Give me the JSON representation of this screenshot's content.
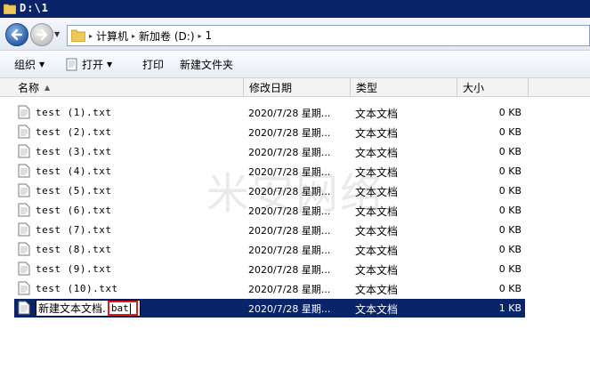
{
  "window": {
    "title": "D:\\1"
  },
  "address": {
    "crumbs": [
      "计算机",
      "新加卷 (D:)",
      "1"
    ]
  },
  "toolbar": {
    "organize": "组织",
    "open": "打开",
    "print": "打印",
    "new_folder": "新建文件夹"
  },
  "columns": {
    "name": "名称",
    "date": "修改日期",
    "type": "类型",
    "size": "大小"
  },
  "files": [
    {
      "name": "test (1).txt",
      "date": "2020/7/28 星期...",
      "type": "文本文档",
      "size": "0 KB"
    },
    {
      "name": "test (2).txt",
      "date": "2020/7/28 星期...",
      "type": "文本文档",
      "size": "0 KB"
    },
    {
      "name": "test (3).txt",
      "date": "2020/7/28 星期...",
      "type": "文本文档",
      "size": "0 KB"
    },
    {
      "name": "test (4).txt",
      "date": "2020/7/28 星期...",
      "type": "文本文档",
      "size": "0 KB"
    },
    {
      "name": "test (5).txt",
      "date": "2020/7/28 星期...",
      "type": "文本文档",
      "size": "0 KB"
    },
    {
      "name": "test (6).txt",
      "date": "2020/7/28 星期...",
      "type": "文本文档",
      "size": "0 KB"
    },
    {
      "name": "test (7).txt",
      "date": "2020/7/28 星期...",
      "type": "文本文档",
      "size": "0 KB"
    },
    {
      "name": "test (8).txt",
      "date": "2020/7/28 星期...",
      "type": "文本文档",
      "size": "0 KB"
    },
    {
      "name": "test (9).txt",
      "date": "2020/7/28 星期...",
      "type": "文本文档",
      "size": "0 KB"
    },
    {
      "name": "test (10).txt",
      "date": "2020/7/28 星期...",
      "type": "文本文档",
      "size": "0 KB"
    }
  ],
  "renaming": {
    "name_base": "新建文本文档.",
    "name_ext": "bat",
    "date": "2020/7/28 星期...",
    "type": "文本文档",
    "size": "1 KB"
  },
  "watermark": "米安网络",
  "colors": {
    "titlebar": "#0a246a",
    "selection": "#0a246a",
    "highlight_border": "#e01b1b"
  }
}
